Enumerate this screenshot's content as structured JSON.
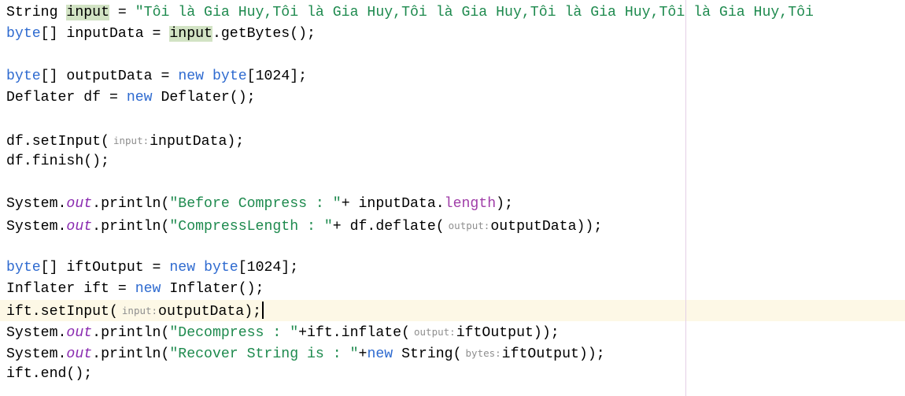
{
  "editor": {
    "lines": [
      [
        {
          "t": "String ",
          "c": ""
        },
        {
          "t": "input",
          "c": "hl"
        },
        {
          "t": " = ",
          "c": ""
        },
        {
          "t": "\"Tôi là Gia Huy,Tôi là Gia Huy,Tôi là Gia Huy,Tôi là Gia Huy,Tôi là Gia Huy,Tôi ",
          "c": "str"
        }
      ],
      [
        {
          "t": "byte",
          "c": "kw"
        },
        {
          "t": "[] inputData = ",
          "c": ""
        },
        {
          "t": "input",
          "c": "hl"
        },
        {
          "t": ".getBytes();",
          "c": ""
        }
      ],
      [],
      [
        {
          "t": "byte",
          "c": "kw"
        },
        {
          "t": "[] outputData = ",
          "c": ""
        },
        {
          "t": "new",
          "c": "kw"
        },
        {
          "t": " ",
          "c": ""
        },
        {
          "t": "byte",
          "c": "kw"
        },
        {
          "t": "[1024];",
          "c": ""
        }
      ],
      [
        {
          "t": "Deflater df = ",
          "c": ""
        },
        {
          "t": "new",
          "c": "kw"
        },
        {
          "t": " Deflater();",
          "c": ""
        }
      ],
      [],
      [
        {
          "t": "df.setInput(",
          "c": ""
        },
        {
          "t": "input:",
          "c": "hint"
        },
        {
          "t": "inputData);",
          "c": ""
        }
      ],
      [
        {
          "t": "df.finish();",
          "c": ""
        }
      ],
      [],
      [
        {
          "t": "System.",
          "c": ""
        },
        {
          "t": "out",
          "c": "fld"
        },
        {
          "t": ".println(",
          "c": ""
        },
        {
          "t": "\"Before Compress : \"",
          "c": "str"
        },
        {
          "t": "+ inputData.",
          "c": ""
        },
        {
          "t": "length",
          "c": "prop"
        },
        {
          "t": ");",
          "c": ""
        }
      ],
      [
        {
          "t": "System.",
          "c": ""
        },
        {
          "t": "out",
          "c": "fld"
        },
        {
          "t": ".println(",
          "c": ""
        },
        {
          "t": "\"CompressLength : \"",
          "c": "str"
        },
        {
          "t": "+ df.deflate(",
          "c": ""
        },
        {
          "t": "output:",
          "c": "hint"
        },
        {
          "t": "outputData));",
          "c": ""
        }
      ],
      [],
      [
        {
          "t": "byte",
          "c": "kw"
        },
        {
          "t": "[] iftOutput = ",
          "c": ""
        },
        {
          "t": "new",
          "c": "kw"
        },
        {
          "t": " ",
          "c": ""
        },
        {
          "t": "byte",
          "c": "kw"
        },
        {
          "t": "[1024];",
          "c": ""
        }
      ],
      [
        {
          "t": "Inflater ift = ",
          "c": ""
        },
        {
          "t": "new",
          "c": "kw"
        },
        {
          "t": " Inflater();",
          "c": ""
        }
      ],
      [
        {
          "t": "ift.setInput(",
          "c": ""
        },
        {
          "t": "input:",
          "c": "hint"
        },
        {
          "t": "outputData);",
          "c": ""
        },
        {
          "t": "",
          "c": "caret"
        }
      ],
      [
        {
          "t": "System.",
          "c": ""
        },
        {
          "t": "out",
          "c": "fld"
        },
        {
          "t": ".println(",
          "c": ""
        },
        {
          "t": "\"Decompress : \"",
          "c": "str"
        },
        {
          "t": "+ift.inflate(",
          "c": ""
        },
        {
          "t": "output:",
          "c": "hint"
        },
        {
          "t": "iftOutput));",
          "c": ""
        }
      ],
      [
        {
          "t": "System.",
          "c": ""
        },
        {
          "t": "out",
          "c": "fld"
        },
        {
          "t": ".println(",
          "c": ""
        },
        {
          "t": "\"Recover String is : \"",
          "c": "str"
        },
        {
          "t": "+",
          "c": ""
        },
        {
          "t": "new",
          "c": "kw"
        },
        {
          "t": " String(",
          "c": ""
        },
        {
          "t": "bytes:",
          "c": "hint"
        },
        {
          "t": "iftOutput));",
          "c": ""
        }
      ],
      [
        {
          "t": "ift.end();",
          "c": ""
        }
      ]
    ]
  }
}
